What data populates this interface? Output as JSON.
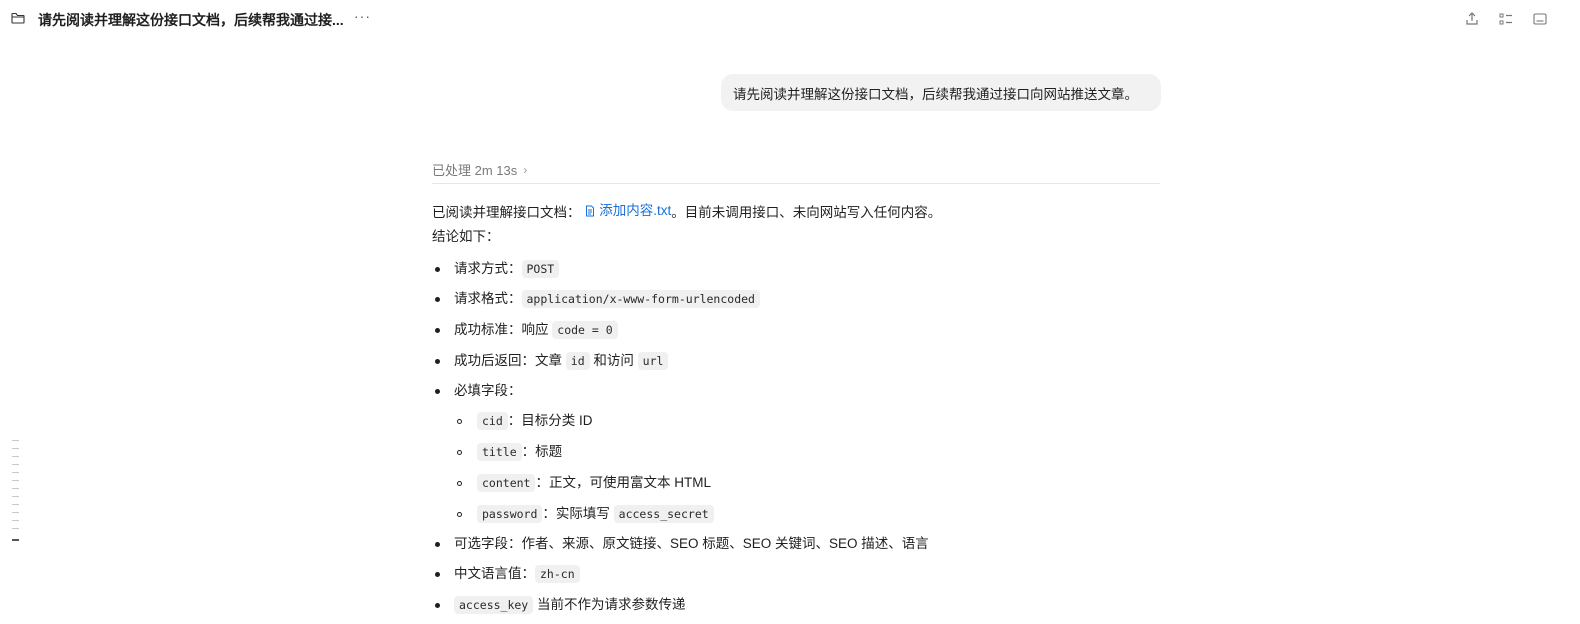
{
  "header": {
    "title": "请先阅读并理解这份接口文档，后续帮我通过接...",
    "more_label": "···",
    "icons": [
      "folder-icon",
      "share-icon",
      "list-icon",
      "panel-icon"
    ]
  },
  "user_message": "请先阅读并理解这份接口文档，后续帮我通过接口向网站推送文章。",
  "processing": {
    "label": "已处理 2m 13s",
    "chevron": "›"
  },
  "answer": {
    "intro_prefix": "已阅读并理解接口文档：",
    "file_name": "添加内容.txt",
    "intro_suffix": "。目前未调用接口、未向网站写入任何内容。",
    "conclusion": "结论如下：",
    "method_label": "请求方式：",
    "method_value": "POST",
    "format_label": "请求格式：",
    "format_value": "application/x-www-form-urlencoded",
    "success_label": "成功标准：响应",
    "success_value": "code = 0",
    "return_label": "成功后返回：文章",
    "return_id": "id",
    "return_mid": "和访问",
    "return_url": "url",
    "required_label": "必填字段：",
    "required_fields": [
      {
        "code": "cid",
        "desc": "：目标分类 ID"
      },
      {
        "code": "title",
        "desc": "：标题"
      },
      {
        "code": "content",
        "desc": "：正文，可使用富文本 HTML"
      },
      {
        "code": "password",
        "desc": "：实际填写",
        "extra_code": "access_secret"
      }
    ],
    "optional_label": "可选字段：作者、来源、原文链接、SEO 标题、SEO 关键词、SEO 描述、语言",
    "lang_label": "中文语言值：",
    "lang_value": "zh-cn",
    "access_key_code": "access_key",
    "access_key_desc": "当前不作为请求参数传递"
  },
  "colors": {
    "link": "#1a6fd8",
    "bubble": "#f2f2f2",
    "code_bg": "#f0f0f0",
    "muted": "#7a7a7a"
  }
}
